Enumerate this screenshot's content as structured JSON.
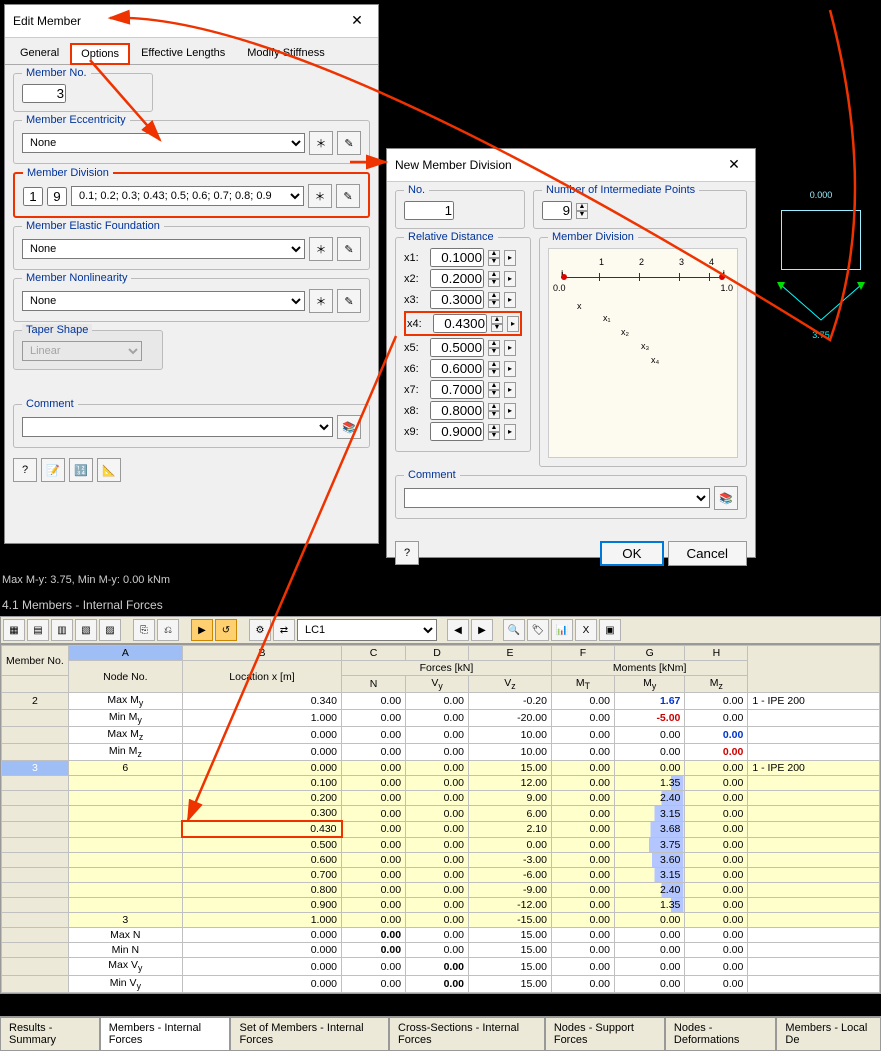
{
  "editMember": {
    "title": "Edit Member",
    "tabs": [
      "General",
      "Options",
      "Effective Lengths",
      "Modify Stiffness"
    ],
    "activeTab": "Options",
    "memberNo": {
      "label": "Member No.",
      "value": "3"
    },
    "eccentricity": {
      "label": "Member Eccentricity",
      "value": "None"
    },
    "division": {
      "label": "Member Division",
      "no": "1",
      "count": "9",
      "list": "0.1; 0.2; 0.3; 0.43; 0.5; 0.6; 0.7; 0.8; 0.9"
    },
    "elastic": {
      "label": "Member Elastic Foundation",
      "value": "None"
    },
    "nonlinearity": {
      "label": "Member Nonlinearity",
      "value": "None"
    },
    "taper": {
      "label": "Taper Shape",
      "value": "Linear"
    },
    "comment": {
      "label": "Comment"
    }
  },
  "newDivision": {
    "title": "New Member Division",
    "noLabel": "No.",
    "noValue": "1",
    "numPtsLabel": "Number of Intermediate Points",
    "numPtsValue": "9",
    "relLabel": "Relative Distance",
    "distances": [
      {
        "k": "x1:",
        "v": "0.1000"
      },
      {
        "k": "x2:",
        "v": "0.2000"
      },
      {
        "k": "x3:",
        "v": "0.3000"
      },
      {
        "k": "x4:",
        "v": "0.4300"
      },
      {
        "k": "x5:",
        "v": "0.5000"
      },
      {
        "k": "x6:",
        "v": "0.6000"
      },
      {
        "k": "x7:",
        "v": "0.7000"
      },
      {
        "k": "x8:",
        "v": "0.8000"
      },
      {
        "k": "x9:",
        "v": "0.9000"
      }
    ],
    "previewLabel": "Member Division",
    "commentLabel": "Comment",
    "ok": "OK",
    "cancel": "Cancel"
  },
  "status": "Max M-y: 3.75, Min M-y: 0.00 kNm",
  "tableTitle": "4.1 Members - Internal Forces",
  "lc": "LC1",
  "colLetters": [
    "A",
    "B",
    "C",
    "D",
    "E",
    "F",
    "G",
    "H"
  ],
  "headerGroups": {
    "member": "Member No.",
    "node": "Node No.",
    "loc": "Location x [m]",
    "forces": "Forces [kN]",
    "moments": "Moments [kNm]"
  },
  "cols": [
    "N",
    "V_y",
    "V_z",
    "M_T",
    "M_y",
    "M_z"
  ],
  "rows": [
    {
      "no": "2",
      "node": "Max M_y",
      "x": "0.340",
      "n": "0.00",
      "vy": "0.00",
      "vz": "-0.20",
      "mt": "0.00",
      "my": "1.67",
      "mz": "0.00",
      "sec": "1 - IPE 200",
      "myC": "blue bold"
    },
    {
      "node": "Min M_y",
      "x": "1.000",
      "n": "0.00",
      "vy": "0.00",
      "vz": "-20.00",
      "mt": "0.00",
      "my": "-5.00",
      "mz": "0.00",
      "myC": "red bold",
      "vzB": 60
    },
    {
      "node": "Max M_z",
      "x": "0.000",
      "n": "0.00",
      "vy": "0.00",
      "vz": "10.00",
      "mt": "0.00",
      "my": "0.00",
      "mz": "0.00",
      "mzC": "blue bold"
    },
    {
      "node": "Min M_z",
      "x": "0.000",
      "n": "0.00",
      "vy": "0.00",
      "vz": "10.00",
      "mt": "0.00",
      "my": "0.00",
      "mz": "0.00",
      "mzC": "red bold"
    },
    {
      "no": "3",
      "node": "6",
      "x": "0.000",
      "n": "0.00",
      "vy": "0.00",
      "vz": "15.00",
      "mt": "0.00",
      "my": "0.00",
      "mz": "0.00",
      "sec": "1 - IPE 200",
      "y": true,
      "sel": true
    },
    {
      "x": "0.100",
      "n": "0.00",
      "vy": "0.00",
      "vz": "12.00",
      "mt": "0.00",
      "my": "1.35",
      "mz": "0.00",
      "y": true,
      "myB": 18
    },
    {
      "x": "0.200",
      "n": "0.00",
      "vy": "0.00",
      "vz": "9.00",
      "mt": "0.00",
      "my": "2.40",
      "mz": "0.00",
      "y": true,
      "myB": 32
    },
    {
      "x": "0.300",
      "n": "0.00",
      "vy": "0.00",
      "vz": "6.00",
      "mt": "0.00",
      "my": "3.15",
      "mz": "0.00",
      "y": true,
      "myB": 42
    },
    {
      "x": "0.430",
      "n": "0.00",
      "vy": "0.00",
      "vz": "2.10",
      "mt": "0.00",
      "my": "3.68",
      "mz": "0.00",
      "y": true,
      "myB": 48,
      "hlX": true
    },
    {
      "x": "0.500",
      "n": "0.00",
      "vy": "0.00",
      "vz": "0.00",
      "mt": "0.00",
      "my": "3.75",
      "mz": "0.00",
      "y": true,
      "myB": 50
    },
    {
      "x": "0.600",
      "n": "0.00",
      "vy": "0.00",
      "vz": "-3.00",
      "mt": "0.00",
      "my": "3.60",
      "mz": "0.00",
      "y": true,
      "vzB": 12,
      "myB": 46
    },
    {
      "x": "0.700",
      "n": "0.00",
      "vy": "0.00",
      "vz": "-6.00",
      "mt": "0.00",
      "my": "3.15",
      "mz": "0.00",
      "y": true,
      "vzB": 22,
      "myB": 42
    },
    {
      "x": "0.800",
      "n": "0.00",
      "vy": "0.00",
      "vz": "-9.00",
      "mt": "0.00",
      "my": "2.40",
      "mz": "0.00",
      "y": true,
      "vzB": 32,
      "myB": 32
    },
    {
      "x": "0.900",
      "n": "0.00",
      "vy": "0.00",
      "vz": "-12.00",
      "mt": "0.00",
      "my": "1.35",
      "mz": "0.00",
      "y": true,
      "vzB": 42,
      "myB": 18
    },
    {
      "node": "3",
      "x": "1.000",
      "n": "0.00",
      "vy": "0.00",
      "vz": "-15.00",
      "mt": "0.00",
      "my": "0.00",
      "mz": "0.00",
      "y": true,
      "vzB": 52
    },
    {
      "node": "Max N",
      "x": "0.000",
      "n": "0.00",
      "vy": "0.00",
      "vz": "15.00",
      "mt": "0.00",
      "my": "0.00",
      "mz": "0.00",
      "nC": "bold"
    },
    {
      "node": "Min N",
      "x": "0.000",
      "n": "0.00",
      "vy": "0.00",
      "vz": "15.00",
      "mt": "0.00",
      "my": "0.00",
      "mz": "0.00",
      "nC": "bold"
    },
    {
      "node": "Max V_y",
      "x": "0.000",
      "n": "0.00",
      "vy": "0.00",
      "vz": "15.00",
      "mt": "0.00",
      "my": "0.00",
      "mz": "0.00",
      "vyC": "bold"
    },
    {
      "node": "Min V_y",
      "x": "0.000",
      "n": "0.00",
      "vy": "0.00",
      "vz": "15.00",
      "mt": "0.00",
      "my": "0.00",
      "mz": "0.00",
      "vyC": "bold"
    }
  ],
  "bTabs": [
    "Results - Summary",
    "Members - Internal Forces",
    "Set of Members - Internal Forces",
    "Cross-Sections - Internal Forces",
    "Nodes - Support Forces",
    "Nodes - Deformations",
    "Members - Local De"
  ],
  "bActive": "Members - Internal Forces",
  "preview": {
    "top": "0.000",
    "bottom": "3.75"
  }
}
